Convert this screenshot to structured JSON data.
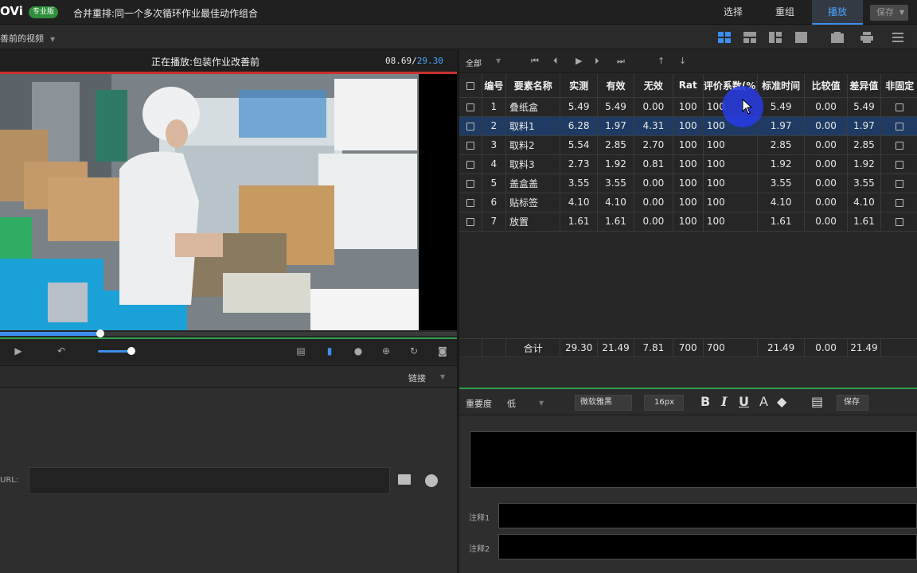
{
  "app": {
    "logo": "OVi",
    "badge": "专业版",
    "title": "合并重排:同一个多次循环作业最佳动作组合"
  },
  "top_nav": {
    "select": "选择",
    "regroup": "重组",
    "play": "播放",
    "save": "保存",
    "active": "播放"
  },
  "video_toolbar": {
    "dropdown": "善前的视频"
  },
  "player": {
    "now_playing": "正在播放:包装作业改善前",
    "time_current": "08.69/",
    "time_total": "29.30",
    "progress": 0.22
  },
  "link_panel": {
    "label": "链接",
    "url_label": "URL:",
    "url_value": ""
  },
  "table_toolbar": {
    "filter": "全部"
  },
  "table": {
    "headers": [
      "",
      "编号",
      "要素名称",
      "实测",
      "有效",
      "无效",
      "Rat",
      "评价系数(%)",
      "标准时间",
      "比较值",
      "差异值",
      "非固定"
    ],
    "rows": [
      {
        "id": "1",
        "name": "叠纸盒",
        "measured": "5.49",
        "effective": "5.49",
        "invalid": "0.00",
        "rat": "100",
        "coef": "100",
        "std": "5.49",
        "cmp": "0.00",
        "diff": "5.49"
      },
      {
        "id": "2",
        "name": "取料1",
        "measured": "6.28",
        "effective": "1.97",
        "invalid": "4.31",
        "rat": "100",
        "coef": "100",
        "std": "1.97",
        "cmp": "0.00",
        "diff": "1.97"
      },
      {
        "id": "3",
        "name": "取料2",
        "measured": "5.54",
        "effective": "2.85",
        "invalid": "2.70",
        "rat": "100",
        "coef": "100",
        "std": "2.85",
        "cmp": "0.00",
        "diff": "2.85"
      },
      {
        "id": "4",
        "name": "取料3",
        "measured": "2.73",
        "effective": "1.92",
        "invalid": "0.81",
        "rat": "100",
        "coef": "100",
        "std": "1.92",
        "cmp": "0.00",
        "diff": "1.92"
      },
      {
        "id": "5",
        "name": "盖盒盖",
        "measured": "3.55",
        "effective": "3.55",
        "invalid": "0.00",
        "rat": "100",
        "coef": "100",
        "std": "3.55",
        "cmp": "0.00",
        "diff": "3.55"
      },
      {
        "id": "6",
        "name": "贴标签",
        "measured": "4.10",
        "effective": "4.10",
        "invalid": "0.00",
        "rat": "100",
        "coef": "100",
        "std": "4.10",
        "cmp": "0.00",
        "diff": "4.10"
      },
      {
        "id": "7",
        "name": "放置",
        "measured": "1.61",
        "effective": "1.61",
        "invalid": "0.00",
        "rat": "100",
        "coef": "100",
        "std": "1.61",
        "cmp": "0.00",
        "diff": "1.61"
      }
    ],
    "selected_row": "2",
    "totals": {
      "label": "合计",
      "measured": "29.30",
      "effective": "21.49",
      "invalid": "7.81",
      "rat": "700",
      "coef": "700",
      "std": "21.49",
      "cmp": "0.00",
      "diff": "21.49"
    }
  },
  "notes": {
    "importance_label": "重要度",
    "importance_value": "低",
    "font": "微软雅黑",
    "size": "16px",
    "bold": "B",
    "italic": "I",
    "underline": "U",
    "font_color": "A",
    "save": "保存",
    "note1_label": "注释1",
    "note2_label": "注释2"
  },
  "colors": {
    "accent": "#3d8ef0",
    "green": "#2fa04a",
    "red": "#c9302c",
    "selected_row": "#1f3b63"
  }
}
